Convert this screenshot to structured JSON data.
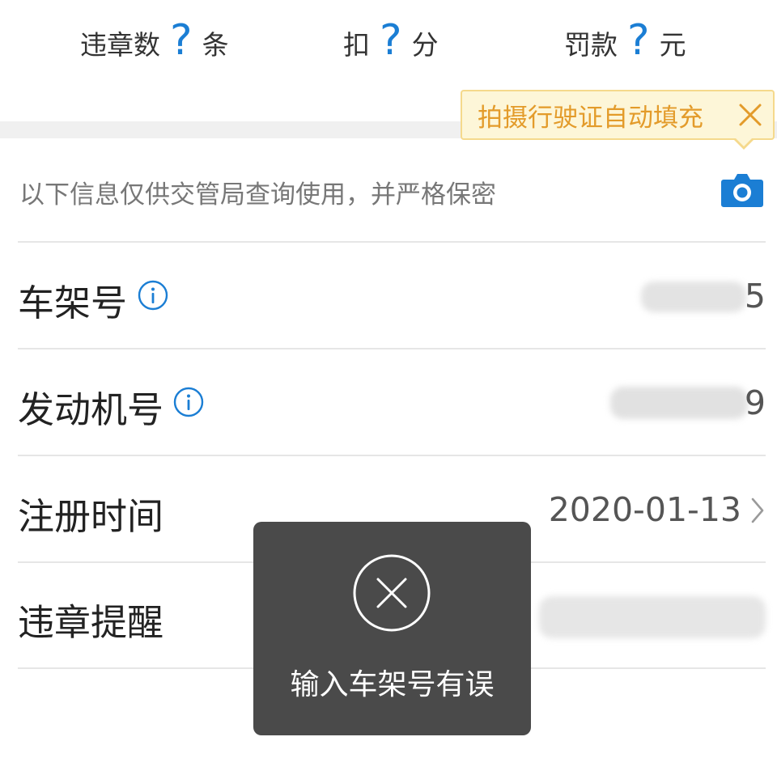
{
  "stats": {
    "violations": {
      "label": "违章数",
      "value": "?",
      "unit": "条"
    },
    "points": {
      "label": "扣",
      "value": "?",
      "unit": "分"
    },
    "fine": {
      "label": "罚款",
      "value": "?",
      "unit": "元"
    }
  },
  "tooltip": {
    "text": "拍摄行驶证自动填充",
    "close_icon": "close-icon"
  },
  "notice": {
    "text": "以下信息仅供交管局查询使用，并严格保密",
    "camera_icon": "camera-icon"
  },
  "form": {
    "vin": {
      "label": "车架号",
      "info_icon": "info-icon",
      "value_visible": "5"
    },
    "engine": {
      "label": "发动机号",
      "info_icon": "info-icon",
      "value_visible": "9"
    },
    "register_date": {
      "label": "注册时间",
      "value": "2020-01-13",
      "chevron_icon": "chevron-right-icon"
    },
    "violation_reminder": {
      "label": "违章提醒"
    }
  },
  "toast": {
    "icon": "error-circle-x-icon",
    "message": "输入车架号有误"
  },
  "colors": {
    "accent_blue": "#1b7ed4",
    "tooltip_bg": "#fdf6d8",
    "tooltip_text": "#e39b2a",
    "toast_bg": "#4a4a4a"
  }
}
